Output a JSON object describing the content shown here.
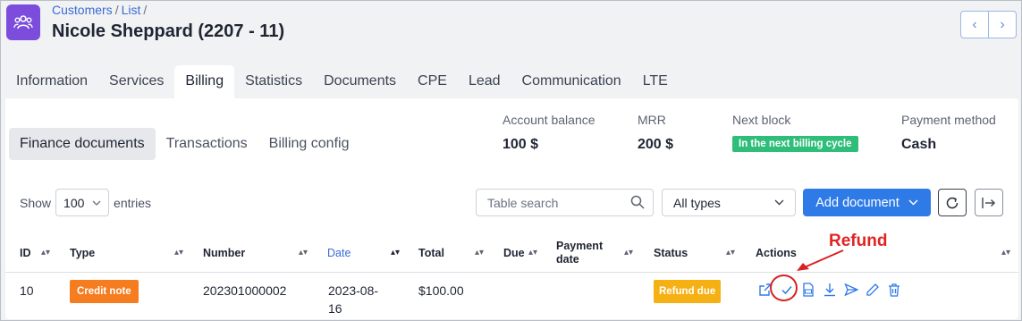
{
  "header": {
    "breadcrumb": [
      "Customers",
      "List"
    ],
    "title": "Nicole Sheppard (2207 - 11)"
  },
  "main_tabs": [
    {
      "label": "Information",
      "active": false
    },
    {
      "label": "Services",
      "active": false
    },
    {
      "label": "Billing",
      "active": true
    },
    {
      "label": "Statistics",
      "active": false
    },
    {
      "label": "Documents",
      "active": false
    },
    {
      "label": "CPE",
      "active": false
    },
    {
      "label": "Lead",
      "active": false
    },
    {
      "label": "Communication",
      "active": false
    },
    {
      "label": "LTE",
      "active": false
    }
  ],
  "sub_tabs": [
    {
      "label": "Finance documents",
      "active": true
    },
    {
      "label": "Transactions",
      "active": false
    },
    {
      "label": "Billing config",
      "active": false
    }
  ],
  "stats": {
    "balance_label": "Account balance",
    "balance_value": "100 $",
    "mrr_label": "MRR",
    "mrr_value": "200 $",
    "next_block_label": "Next block",
    "next_block_value": "In the next billing cycle",
    "payment_label": "Payment method",
    "payment_value": "Cash"
  },
  "controls": {
    "show_label": "Show",
    "entries_value": "100",
    "entries_label": "entries",
    "search_placeholder": "Table search",
    "type_select": "All types",
    "add_label": "Add document"
  },
  "table": {
    "columns": [
      "ID",
      "Type",
      "Number",
      "Date",
      "Total",
      "Due",
      "Payment\ndate",
      "Status",
      "Actions"
    ],
    "col_payment_1": "Payment",
    "col_payment_2": "date",
    "rows": [
      {
        "id": "10",
        "type": "Credit note",
        "number": "202301000002",
        "date_1": "2023-08-",
        "date_2": "16",
        "total": "$100.00",
        "due": "",
        "payment_date": "",
        "status": "Refund due"
      }
    ]
  },
  "annotation": {
    "label": "Refund"
  },
  "colors": {
    "accent": "#2e7ae6",
    "brand": "#7c4ddc",
    "badge_credit_note": "#f57c1f",
    "badge_refund_due": "#f5b014",
    "badge_next_block": "#2fbe7a",
    "annotation": "#e02424"
  }
}
